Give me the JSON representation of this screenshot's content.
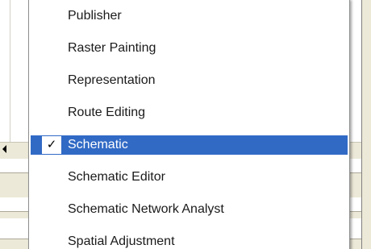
{
  "menu": {
    "items": [
      {
        "label": "Publisher",
        "checked": false,
        "selected": false
      },
      {
        "label": "Raster Painting",
        "checked": false,
        "selected": false
      },
      {
        "label": "Representation",
        "checked": false,
        "selected": false
      },
      {
        "label": "Route Editing",
        "checked": false,
        "selected": false
      },
      {
        "label": "Schematic",
        "checked": true,
        "selected": true
      },
      {
        "label": "Schematic Editor",
        "checked": false,
        "selected": false
      },
      {
        "label": "Schematic Network Analyst",
        "checked": false,
        "selected": false
      },
      {
        "label": "Spatial Adjustment",
        "checked": false,
        "selected": false
      }
    ],
    "check_glyph": "✓"
  },
  "colors": {
    "selection": "#316ac5",
    "menu_border": "#8e8f8f",
    "window_face": "#ece9d8"
  },
  "icons": {
    "check": "checkmark-icon",
    "scroll_left": "scroll-left-arrow-icon"
  }
}
